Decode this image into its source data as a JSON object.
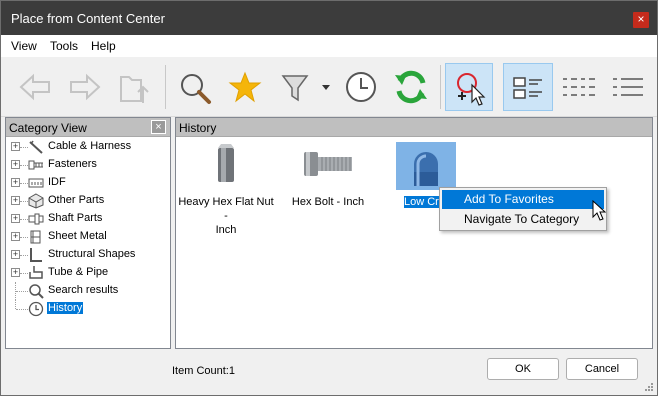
{
  "window": {
    "title": "Place from Content Center",
    "close_glyph": "×"
  },
  "menu": {
    "items": [
      "View",
      "Tools",
      "Help"
    ]
  },
  "toolbar": {
    "buttons": [
      {
        "name": "back",
        "icon": "arrow-left-icon",
        "enabled": false
      },
      {
        "name": "forward",
        "icon": "arrow-right-icon",
        "enabled": false
      },
      {
        "name": "up-level",
        "icon": "folder-up-icon",
        "enabled": false
      },
      {
        "name": "search",
        "icon": "magnifier-icon",
        "enabled": true
      },
      {
        "name": "favorites",
        "icon": "star-icon",
        "enabled": true
      },
      {
        "name": "filter",
        "icon": "funnel-icon",
        "enabled": true
      },
      {
        "name": "history",
        "icon": "clock-icon",
        "enabled": true
      },
      {
        "name": "refresh",
        "icon": "refresh-icon",
        "enabled": true
      },
      {
        "name": "autodrop",
        "icon": "autodrop-icon",
        "active": true
      },
      {
        "name": "view-thumbnails",
        "icon": "thumbnail-view-icon",
        "active": true
      },
      {
        "name": "view-list",
        "icon": "list-view-icon",
        "active": false
      },
      {
        "name": "view-details",
        "icon": "detail-view-icon",
        "active": false
      }
    ]
  },
  "left_panel": {
    "header": "Category View",
    "close_glyph": "×",
    "tree": [
      {
        "label": "Cable & Harness",
        "expandable": true,
        "icon": "cable-icon"
      },
      {
        "label": "Fasteners",
        "expandable": true,
        "icon": "fastener-icon"
      },
      {
        "label": "IDF",
        "expandable": true,
        "icon": "idf-icon"
      },
      {
        "label": "Other Parts",
        "expandable": true,
        "icon": "other-parts-icon"
      },
      {
        "label": "Shaft Parts",
        "expandable": true,
        "icon": "shaft-icon"
      },
      {
        "label": "Sheet Metal",
        "expandable": true,
        "icon": "sheet-metal-icon"
      },
      {
        "label": "Structural Shapes",
        "expandable": true,
        "icon": "structural-icon"
      },
      {
        "label": "Tube & Pipe",
        "expandable": true,
        "icon": "tube-pipe-icon"
      },
      {
        "label": "Search results",
        "expandable": false,
        "icon": "search-results-icon"
      },
      {
        "label": "History",
        "expandable": false,
        "icon": "history-icon",
        "selected": true
      }
    ]
  },
  "right_panel": {
    "header": "History",
    "items": [
      {
        "caption_line1": "Heavy Hex Flat Nut -",
        "caption_line2": "Inch",
        "icon": "hex-nut-icon"
      },
      {
        "caption_line1": "Hex Bolt - Inch",
        "caption_line2": "",
        "icon": "hex-bolt-icon"
      },
      {
        "caption_line1": "Low Cr",
        "caption_line2": "",
        "icon": "acorn-nut-icon",
        "selected": true
      }
    ]
  },
  "context_menu": {
    "items": [
      {
        "label": "Add To Favorites",
        "highlighted": true
      },
      {
        "label": "Navigate To Category",
        "highlighted": false
      }
    ]
  },
  "footer": {
    "item_count": "Item Count:1",
    "ok_label": "OK",
    "cancel_label": "Cancel"
  },
  "colors": {
    "selection": "#0078d7",
    "titlebar": "#3c3c3c",
    "close": "#c42b1c",
    "star": "#f5b50a",
    "refresh": "#2aa53b"
  }
}
